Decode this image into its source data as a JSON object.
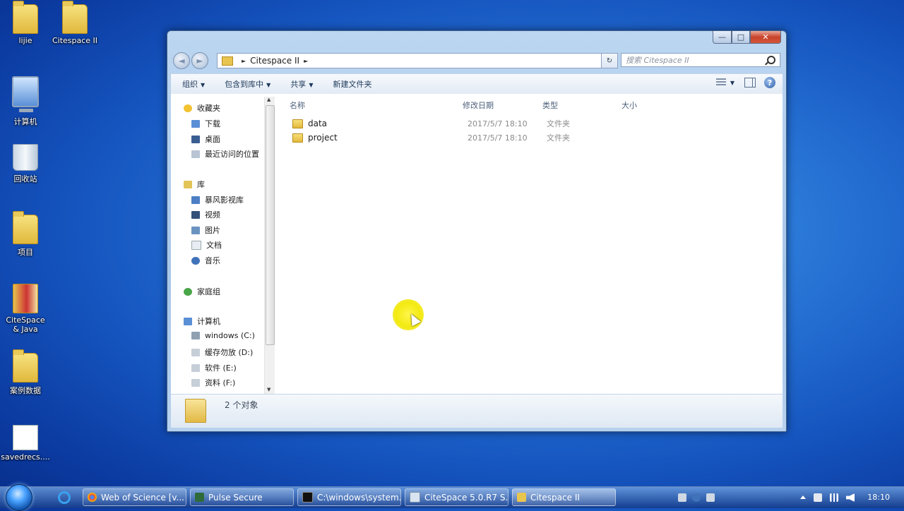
{
  "desktop": {
    "icons": [
      {
        "label": "lijie"
      },
      {
        "label": "Citespace II"
      },
      {
        "label": "计算机"
      },
      {
        "label": "回收站"
      },
      {
        "label": "项目"
      },
      {
        "label": "CiteSpace & Java"
      },
      {
        "label": "案例数据"
      },
      {
        "label": "savedrecs...."
      }
    ]
  },
  "window": {
    "controls": {
      "minimize": "—",
      "maximize": "□",
      "close": "✕"
    },
    "nav": {
      "back": "◄",
      "forward": "►"
    },
    "address": {
      "path_segment": "Citespace II",
      "sep": "►",
      "dropdown": "▼"
    },
    "refresh": "↻",
    "search": {
      "placeholder": "搜索 Citespace II"
    },
    "toolbar": {
      "organize": "组织",
      "include_in_library": "包含到库中",
      "share": "共享",
      "new_folder": "新建文件夹",
      "caret": "▼",
      "help": "?"
    },
    "navpane": {
      "favorites": "收藏夹",
      "downloads": "下载",
      "desktop": "桌面",
      "recent": "最近访问的位置",
      "libraries": "库",
      "storm": "暴风影视库",
      "videos": "视频",
      "pictures": "图片",
      "documents": "文档",
      "music": "音乐",
      "homegroup": "家庭组",
      "computer": "计算机",
      "drive_c": "windows (C:)",
      "drive_d": "缓存勿放 (D:)",
      "drive_e": "软件 (E:)",
      "drive_f": "资料 (F:)",
      "scroll_up": "▲",
      "scroll_down": "▼"
    },
    "columns": {
      "name": "名称",
      "date": "修改日期",
      "type": "类型",
      "size": "大小"
    },
    "files": [
      {
        "name": "data",
        "date": "2017/5/7 18:10",
        "type": "文件夹"
      },
      {
        "name": "project",
        "date": "2017/5/7 18:10",
        "type": "文件夹"
      }
    ],
    "details": {
      "count": "2 个对象"
    }
  },
  "taskbar": {
    "tasks": [
      {
        "label": "Web of Science [v..."
      },
      {
        "label": "Pulse Secure"
      },
      {
        "label": "C:\\windows\\system..."
      },
      {
        "label": "CiteSpace 5.0.R7 S..."
      },
      {
        "label": "Citespace II"
      }
    ],
    "clock": "18:10"
  },
  "colors": {
    "accent": "#1656c0",
    "close_button": "#c8432b",
    "folder": "#e2b93c"
  }
}
